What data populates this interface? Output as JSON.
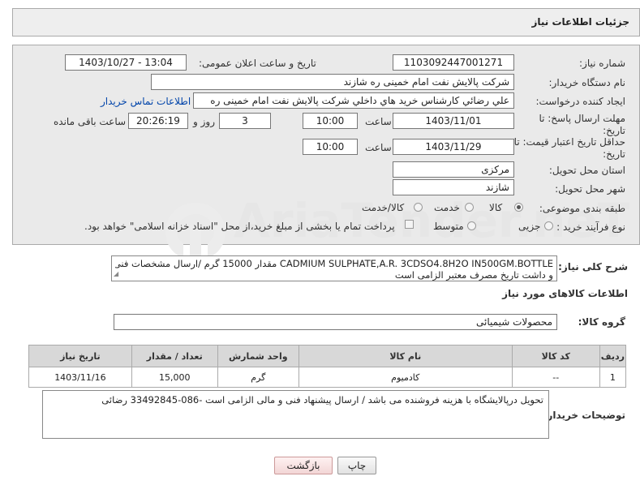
{
  "header": {
    "title": "جزئیات اطلاعات نیاز"
  },
  "form": {
    "need_number_label": "شماره نیاز:",
    "need_number": "1103092447001271",
    "announce_label": "تاریخ و ساعت اعلان عمومی:",
    "announce_value": "1403/10/27 - 13:04",
    "buyer_label": "نام دستگاه خریدار:",
    "buyer_value": "شرکت پالایش نفت امام خمینی  ره  شازند",
    "creator_label": "ایجاد کننده درخواست:",
    "creator_value": "علي  رضائي کارشناس خريد هاي داخلي  شرکت پالایش نفت امام خمینی  ره",
    "contact_link": "اطلاعات تماس خریدار",
    "deadline_label_1": "مهلت ارسال پاسخ: تا",
    "deadline_label_2": "تاریخ:",
    "deadline_date": "1403/11/01",
    "time_label": "ساعت",
    "deadline_time": "10:00",
    "days_value": "3",
    "days_label": "روز و",
    "remaining_time": "20:26:19",
    "remaining_label": "ساعت باقی مانده",
    "validity_label_1": "حداقل تاریخ اعتبار قیمت: تا",
    "validity_label_2": "تاریخ:",
    "validity_date": "1403/11/29",
    "validity_time": "10:00",
    "province_label": "استان محل تحویل:",
    "province_value": "مرکزی",
    "city_label": "شهر محل تحویل:",
    "city_value": "شازند",
    "category_label": "طبقه بندی موضوعی:",
    "category_options": [
      "کالا",
      "خدمت",
      "کالا/خدمت"
    ],
    "process_label": "نوع فرآیند خرید :",
    "process_options": [
      "جزیی",
      "متوسط"
    ],
    "payment_note": "پرداخت تمام یا بخشی از مبلغ خرید،از محل \"اسناد خزانه اسلامی\" خواهد بود."
  },
  "watermark": "AriaTender.neT",
  "description": {
    "label": "شرح کلی نیاز:",
    "line1": "CADMIUM SULPHATE,A.R. 3CDSO4.8H2O IN500GM.BOTTLE    مقدار 15000 گرم /ارسال مشخصات فنی",
    "line2": "و داشت تاریخ مصرف معتبر الزامی است"
  },
  "goods_section_title": "اطلاعات کالاهای مورد نیاز",
  "goods_group": {
    "label": "گروه کالا:",
    "value": "محصولات شیمیائی"
  },
  "table": {
    "headers": [
      "ردیف",
      "کد کالا",
      "نام کالا",
      "واحد شمارش",
      "تعداد / مقدار",
      "تاریخ نیاز"
    ],
    "rows": [
      [
        "1",
        "--",
        "کادمیوم",
        "گرم",
        "15,000",
        "1403/11/16"
      ]
    ]
  },
  "buyer_notes": {
    "label": "توضیحات خریدار:",
    "text": "تحویل درپالایشگاه با  هزینه فروشنده می باشد / ارسال پیشنهاد فنی و مالی الزامی است -086-33492845 رضائی"
  },
  "buttons": {
    "print": "چاپ",
    "back": "بازگشت"
  }
}
